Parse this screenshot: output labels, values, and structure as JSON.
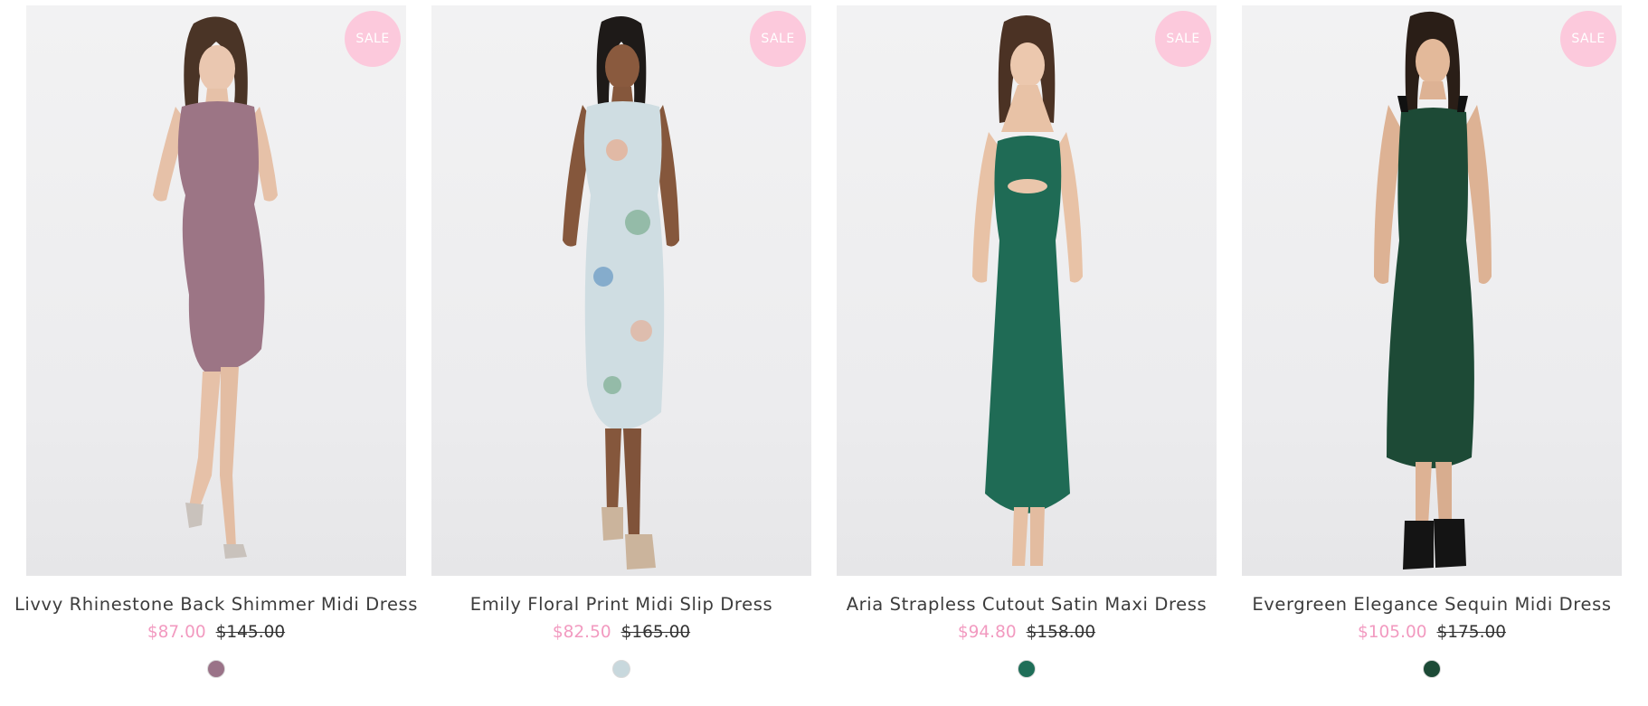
{
  "colors": {
    "badge": "#fcc9dc",
    "sale_price": "#f29ac0"
  },
  "products": [
    {
      "title": "Livvy Rhinestone Back Shimmer Midi Dress",
      "badge": "SALE",
      "sale_price": "$87.00",
      "original_price": "$145.00",
      "swatch_color": "#9a7388",
      "dress_color": "#9c7585"
    },
    {
      "title": "Emily Floral Print Midi Slip Dress",
      "badge": "SALE",
      "sale_price": "$82.50",
      "original_price": "$165.00",
      "swatch_color": "#c8d8dd",
      "dress_color": "#cfdde2"
    },
    {
      "title": "Aria Strapless Cutout Satin Maxi Dress",
      "badge": "SALE",
      "sale_price": "$94.80",
      "original_price": "$158.00",
      "swatch_color": "#1f6e58",
      "dress_color": "#1f6b55"
    },
    {
      "title": "Evergreen Elegance Sequin Midi Dress",
      "badge": "SALE",
      "sale_price": "$105.00",
      "original_price": "$175.00",
      "swatch_color": "#1c4a36",
      "dress_color": "#1d4a36"
    }
  ]
}
